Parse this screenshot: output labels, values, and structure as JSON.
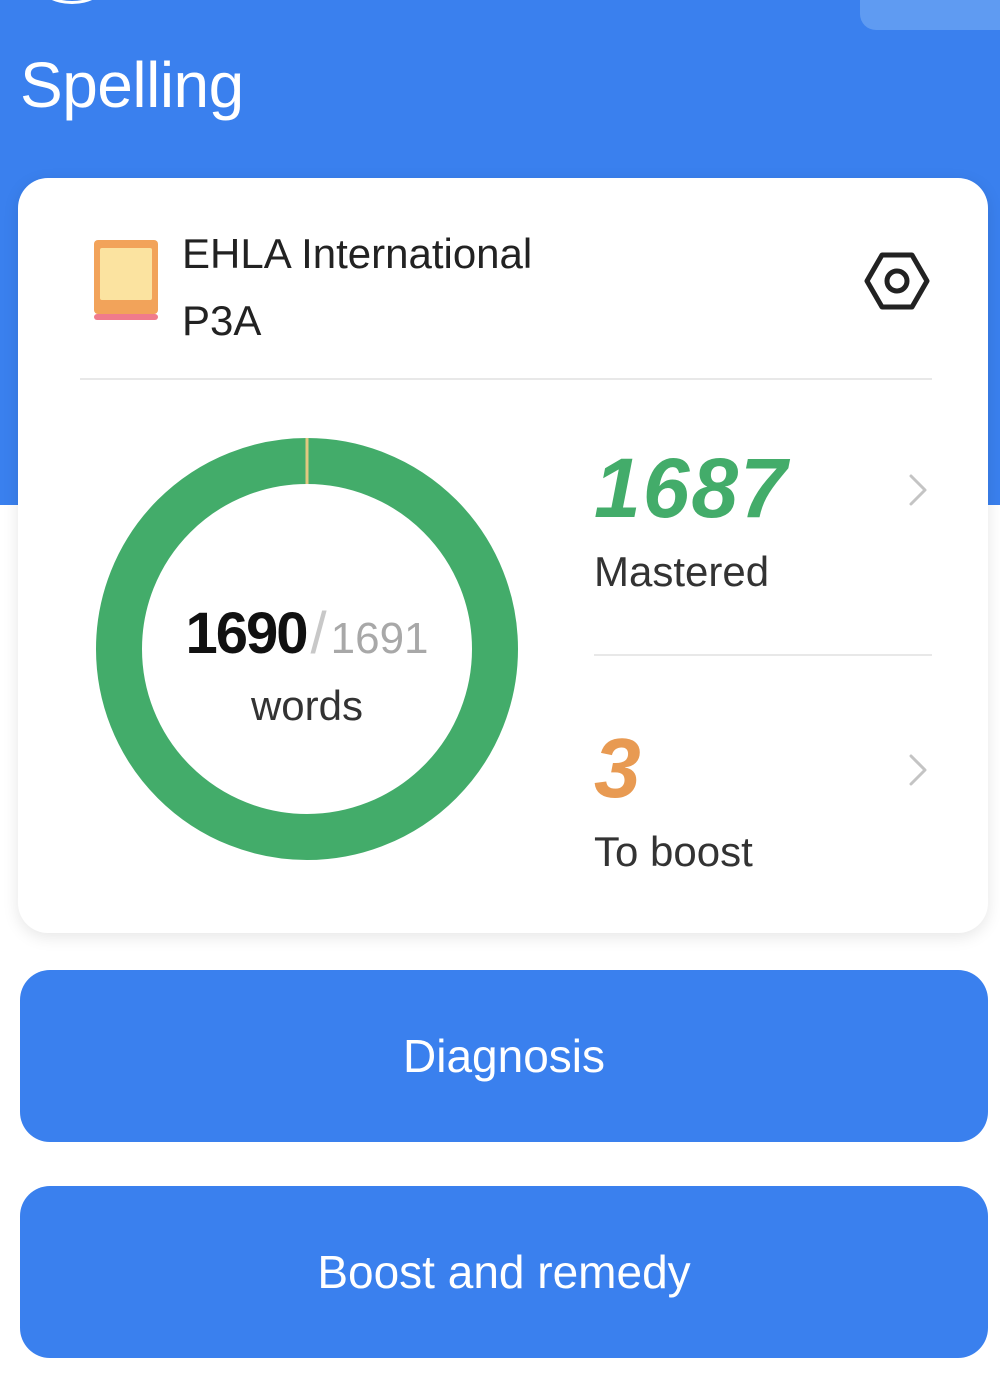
{
  "header": {
    "title": "Spelling",
    "background_color": "#3a80ee"
  },
  "course": {
    "icon": "book-icon",
    "name": "EHLA International",
    "class": "P3A",
    "settings_icon": "settings-hexagon-icon"
  },
  "progress": {
    "learned": "1690",
    "total": "1691",
    "unit": "words",
    "ring_fraction": 0.998,
    "ring_color": "#43ac6a",
    "remaining_color": "#e0c880"
  },
  "stats": {
    "mastered": {
      "value": "1687",
      "label": "Mastered",
      "color": "#43ac6a"
    },
    "to_boost": {
      "value": "3",
      "label": "To boost",
      "color": "#e89a52"
    }
  },
  "actions": {
    "diagnosis_label": "Diagnosis",
    "boost_label": "Boost and remedy"
  }
}
